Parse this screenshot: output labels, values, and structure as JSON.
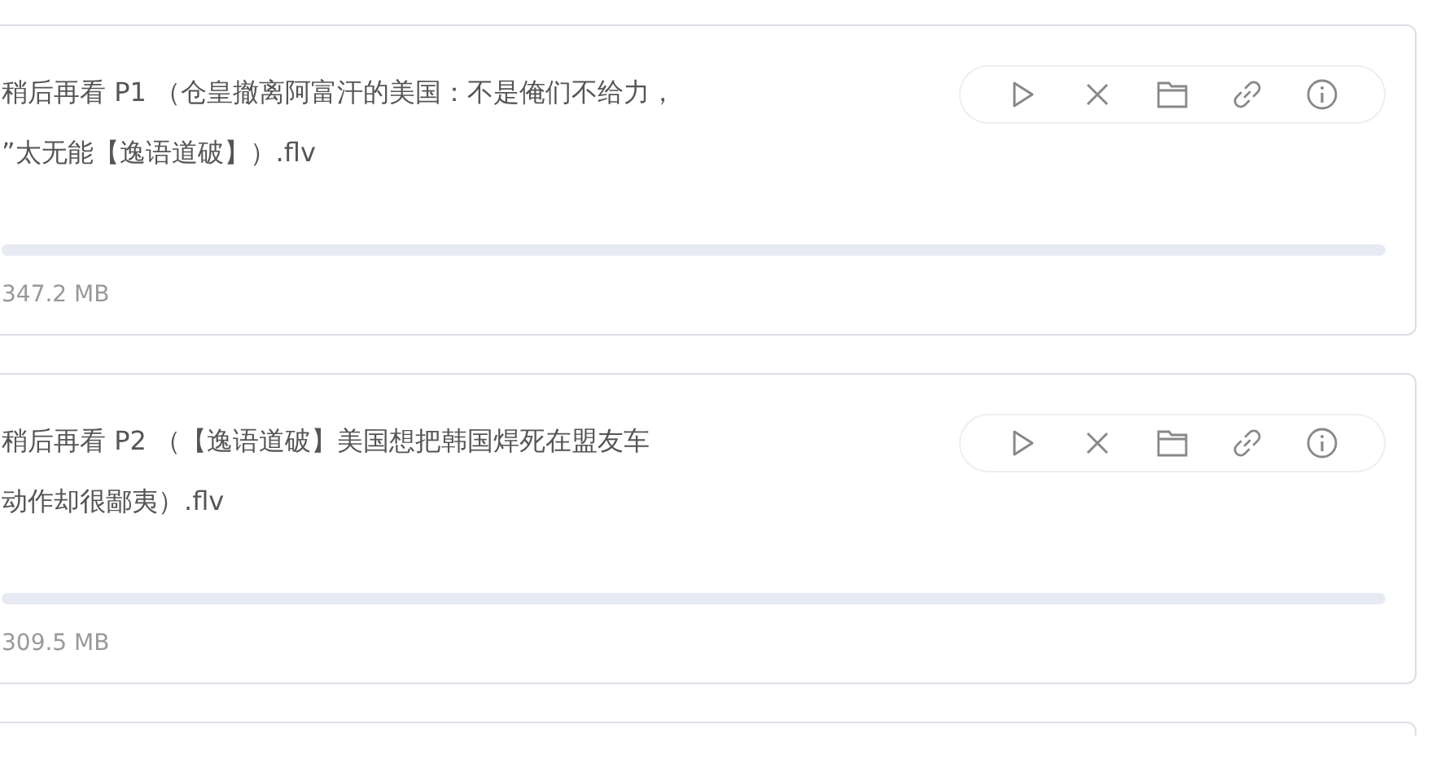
{
  "downloads": [
    {
      "title_lines": [
        "稍后再看 P1 （仓皇撤离阿富汗的美国：不是俺们不给力，",
        "”太无能【逸语道破】）.flv"
      ],
      "size": "347.2 MB"
    },
    {
      "title_lines": [
        "稍后再看 P2 （【逸语道破】美国想把韩国焊死在盟友车",
        "动作却很鄙夷）.flv"
      ],
      "size": "309.5 MB"
    }
  ],
  "actions": [
    {
      "kind": "play"
    },
    {
      "kind": "delete"
    },
    {
      "kind": "folder"
    },
    {
      "kind": "link"
    },
    {
      "kind": "info"
    }
  ]
}
